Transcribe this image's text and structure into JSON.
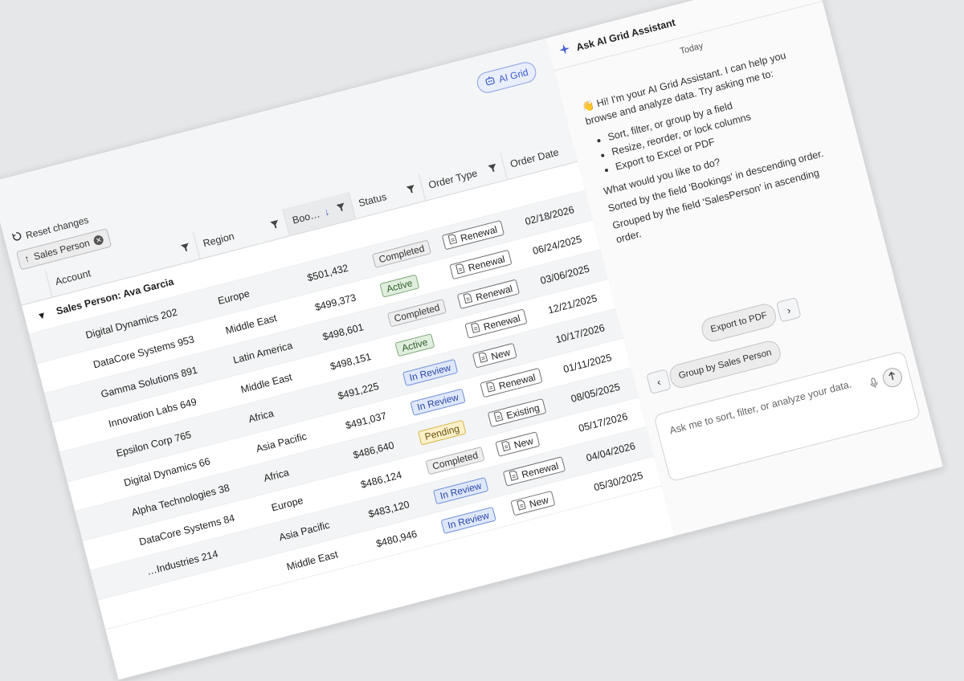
{
  "toolbar": {
    "ai_grid_label": "AI Grid",
    "reset_label": "Reset changes"
  },
  "grouping": {
    "chip_label": "Sales Person"
  },
  "columns": {
    "account": "Account",
    "region": "Region",
    "bookings": "Boo…",
    "status": "Status",
    "order_type": "Order Type",
    "order_date": "Order Date"
  },
  "group": {
    "label": "Sales Person: Ava Garcia"
  },
  "rows": [
    {
      "account": "Digital Dynamics 202",
      "region": "Europe",
      "bookings": "$501,432",
      "status": "Completed",
      "order_type": "Renewal",
      "order_date": "02/18/2026"
    },
    {
      "account": "DataCore Systems 953",
      "region": "Middle East",
      "bookings": "$499,373",
      "status": "Active",
      "order_type": "Renewal",
      "order_date": "06/24/2025"
    },
    {
      "account": "Gamma Solutions 891",
      "region": "Latin America",
      "bookings": "$498,601",
      "status": "Completed",
      "order_type": "Renewal",
      "order_date": "03/06/2025"
    },
    {
      "account": "Innovation Labs 649",
      "region": "Middle East",
      "bookings": "$498,151",
      "status": "Active",
      "order_type": "Renewal",
      "order_date": "12/21/2025"
    },
    {
      "account": "Epsilon Corp 765",
      "region": "Africa",
      "bookings": "$491,225",
      "status": "In Review",
      "order_type": "New",
      "order_date": "10/17/2026"
    },
    {
      "account": "Digital Dynamics 66",
      "region": "Asia Pacific",
      "bookings": "$491,037",
      "status": "In Review",
      "order_type": "Renewal",
      "order_date": "01/11/2025"
    },
    {
      "account": "Alpha Technologies 38",
      "region": "Africa",
      "bookings": "$486,640",
      "status": "Pending",
      "order_type": "Existing",
      "order_date": "08/05/2025"
    },
    {
      "account": "DataCore Systems 84",
      "region": "Europe",
      "bookings": "$486,124",
      "status": "Completed",
      "order_type": "New",
      "order_date": "05/17/2026"
    },
    {
      "account": "…Industries 214",
      "region": "Asia Pacific",
      "bookings": "$483,120",
      "status": "In Review",
      "order_type": "Renewal",
      "order_date": "04/04/2026"
    },
    {
      "account": "",
      "region": "Middle East",
      "bookings": "$480,946",
      "status": "In Review",
      "order_type": "New",
      "order_date": "05/30/2025"
    }
  ],
  "status_colors": {
    "Completed": {
      "bg": "#eeeeef",
      "border": "#b0b3b7",
      "fg": "#333333"
    },
    "Active": {
      "bg": "#dfeedd",
      "border": "#7fa879",
      "fg": "#2c5a27"
    },
    "In Review": {
      "bg": "#dfe8fb",
      "border": "#6f8fdc",
      "fg": "#2a47a8"
    },
    "Pending": {
      "bg": "#fbf0c8",
      "border": "#d7b54a",
      "fg": "#6a5310"
    }
  },
  "assistant": {
    "title": "Ask AI Grid Assistant",
    "date_label": "Today",
    "intro": "👋 Hi! I'm your AI Grid Assistant. I can help you browse and analyze data. Try asking me to:",
    "bullets": [
      "Sort, filter, or group by a field",
      "Resize, reorder, or lock columns",
      "Export to Excel or PDF"
    ],
    "question": "What would you like to do?",
    "result_1": "Sorted by the field 'Bookings' in descending order.",
    "result_2": "Grouped by the field 'SalesPerson' in ascending order.",
    "suggestions": [
      "Group by Sales Person",
      "Export to PDF"
    ],
    "input_placeholder": "Ask me to sort, filter, or analyze your data."
  }
}
